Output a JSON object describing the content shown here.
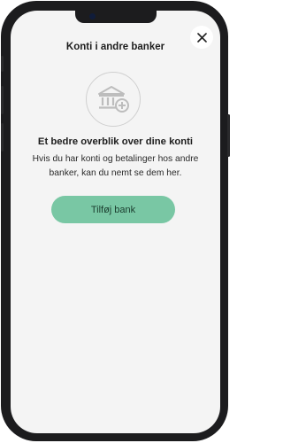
{
  "header": {
    "title": "Konti i andre banker",
    "close_icon": "close-icon"
  },
  "main": {
    "illustration_icon": "bank-add-icon",
    "headline": "Et bedre overblik over dine konti",
    "body": "Hvis du har konti og betalinger hos andre banker, kan du nemt se dem her.",
    "add_bank_label": "Tilføj bank"
  },
  "colors": {
    "button": "#79c7a4",
    "background": "#f4f4f4",
    "frame": "#1c1c1e"
  }
}
